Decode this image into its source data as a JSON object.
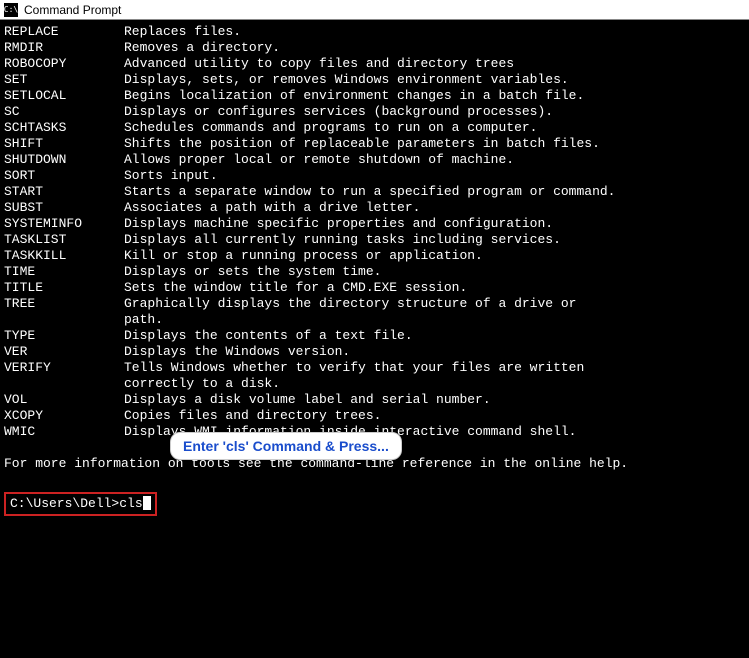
{
  "window": {
    "title": "Command Prompt",
    "icon_label": "C:\\"
  },
  "commands": [
    {
      "name": "REPLACE",
      "desc": "Replaces files."
    },
    {
      "name": "RMDIR",
      "desc": "Removes a directory."
    },
    {
      "name": "ROBOCOPY",
      "desc": "Advanced utility to copy files and directory trees"
    },
    {
      "name": "SET",
      "desc": "Displays, sets, or removes Windows environment variables."
    },
    {
      "name": "SETLOCAL",
      "desc": "Begins localization of environment changes in a batch file."
    },
    {
      "name": "SC",
      "desc": "Displays or configures services (background processes)."
    },
    {
      "name": "SCHTASKS",
      "desc": "Schedules commands and programs to run on a computer."
    },
    {
      "name": "SHIFT",
      "desc": "Shifts the position of replaceable parameters in batch files."
    },
    {
      "name": "SHUTDOWN",
      "desc": "Allows proper local or remote shutdown of machine."
    },
    {
      "name": "SORT",
      "desc": "Sorts input."
    },
    {
      "name": "START",
      "desc": "Starts a separate window to run a specified program or command."
    },
    {
      "name": "SUBST",
      "desc": "Associates a path with a drive letter."
    },
    {
      "name": "SYSTEMINFO",
      "desc": "Displays machine specific properties and configuration."
    },
    {
      "name": "TASKLIST",
      "desc": "Displays all currently running tasks including services."
    },
    {
      "name": "TASKKILL",
      "desc": "Kill or stop a running process or application."
    },
    {
      "name": "TIME",
      "desc": "Displays or sets the system time."
    },
    {
      "name": "TITLE",
      "desc": "Sets the window title for a CMD.EXE session."
    },
    {
      "name": "TREE",
      "desc": "Graphically displays the directory structure of a drive or",
      "cont": "path."
    },
    {
      "name": "TYPE",
      "desc": "Displays the contents of a text file."
    },
    {
      "name": "VER",
      "desc": "Displays the Windows version."
    },
    {
      "name": "VERIFY",
      "desc": "Tells Windows whether to verify that your files are written",
      "cont": "correctly to a disk."
    },
    {
      "name": "VOL",
      "desc": "Displays a disk volume label and serial number."
    },
    {
      "name": "XCOPY",
      "desc": "Copies files and directory trees."
    },
    {
      "name": "WMIC",
      "desc": "Displays WMI information inside interactive command shell."
    }
  ],
  "footer_info": "For more information on tools see the command-line reference in the online help.",
  "prompt": {
    "path": "C:\\Users\\Dell>",
    "input": "cls"
  },
  "callout": {
    "text": "Enter 'cls' Command & Press..."
  }
}
